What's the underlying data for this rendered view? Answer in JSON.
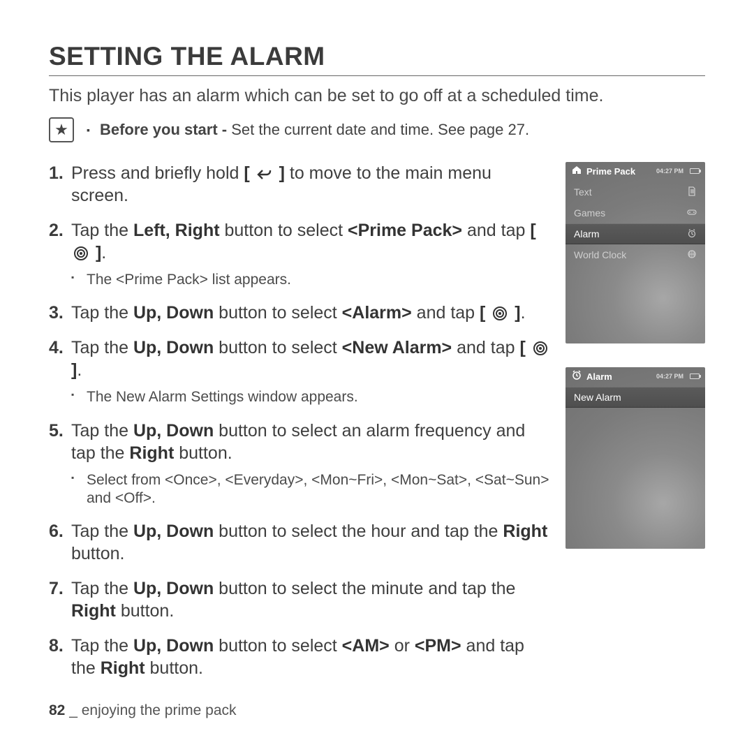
{
  "title": "SETTING THE ALARM",
  "intro": "This player has an alarm which can be set to go off at a scheduled time.",
  "note": {
    "bold": "Before you start - ",
    "rest": "Set the current date and time. See page 27."
  },
  "steps": [
    {
      "pre": "Press and briefly hold ",
      "icon": "back",
      "post": " to move to the main menu screen."
    },
    {
      "parts": [
        "Tap the ",
        {
          "b": "Left, Right"
        },
        " button to select ",
        {
          "b": "<Prime Pack>"
        },
        " and tap "
      ],
      "trailIcon": "select",
      "trail": ".",
      "sub": "The <Prime Pack> list appears."
    },
    {
      "parts": [
        "Tap the ",
        {
          "b": "Up, Down"
        },
        " button to select ",
        {
          "b": "<Alarm>"
        },
        " and tap "
      ],
      "trailIcon": "select",
      "trail": "."
    },
    {
      "parts": [
        "Tap the ",
        {
          "b": "Up, Down"
        },
        " button to select ",
        {
          "b": "<New Alarm>"
        },
        " and tap "
      ],
      "trailIcon": "select",
      "trail": ".",
      "sub": "The New Alarm Settings window appears."
    },
    {
      "parts": [
        "Tap the ",
        {
          "b": "Up, Down"
        },
        " button to select an alarm frequency and tap the ",
        {
          "b": "Right"
        },
        " button."
      ],
      "sub": "Select from <Once>, <Everyday>, <Mon~Fri>, <Mon~Sat>, <Sat~Sun> and <Off>."
    },
    {
      "parts": [
        "Tap the ",
        {
          "b": "Up, Down"
        },
        " button to select the hour and tap the ",
        {
          "b": "Right"
        },
        " button."
      ]
    },
    {
      "parts": [
        "Tap the ",
        {
          "b": "Up, Down"
        },
        " button to select the minute and tap the ",
        {
          "b": "Right"
        },
        " button."
      ]
    },
    {
      "parts": [
        "Tap the ",
        {
          "b": "Up, Down"
        },
        " button to select ",
        {
          "b": "<AM>"
        },
        " or ",
        {
          "b": "<PM>"
        },
        " and tap the ",
        {
          "b": "Right"
        },
        " button."
      ]
    }
  ],
  "device1": {
    "title": "Prime Pack",
    "time": "04:27 PM",
    "items": [
      {
        "label": "Text",
        "icon": "doc"
      },
      {
        "label": "Games",
        "icon": "pad"
      },
      {
        "label": "Alarm",
        "icon": "clock",
        "sel": true
      },
      {
        "label": "World Clock",
        "icon": "globe"
      }
    ]
  },
  "device2": {
    "title": "Alarm",
    "time": "04:27 PM",
    "items": [
      {
        "label": "New Alarm",
        "sel": true
      }
    ]
  },
  "footer": {
    "page": "82",
    "sep": " _ ",
    "section": "enjoying the prime pack"
  }
}
